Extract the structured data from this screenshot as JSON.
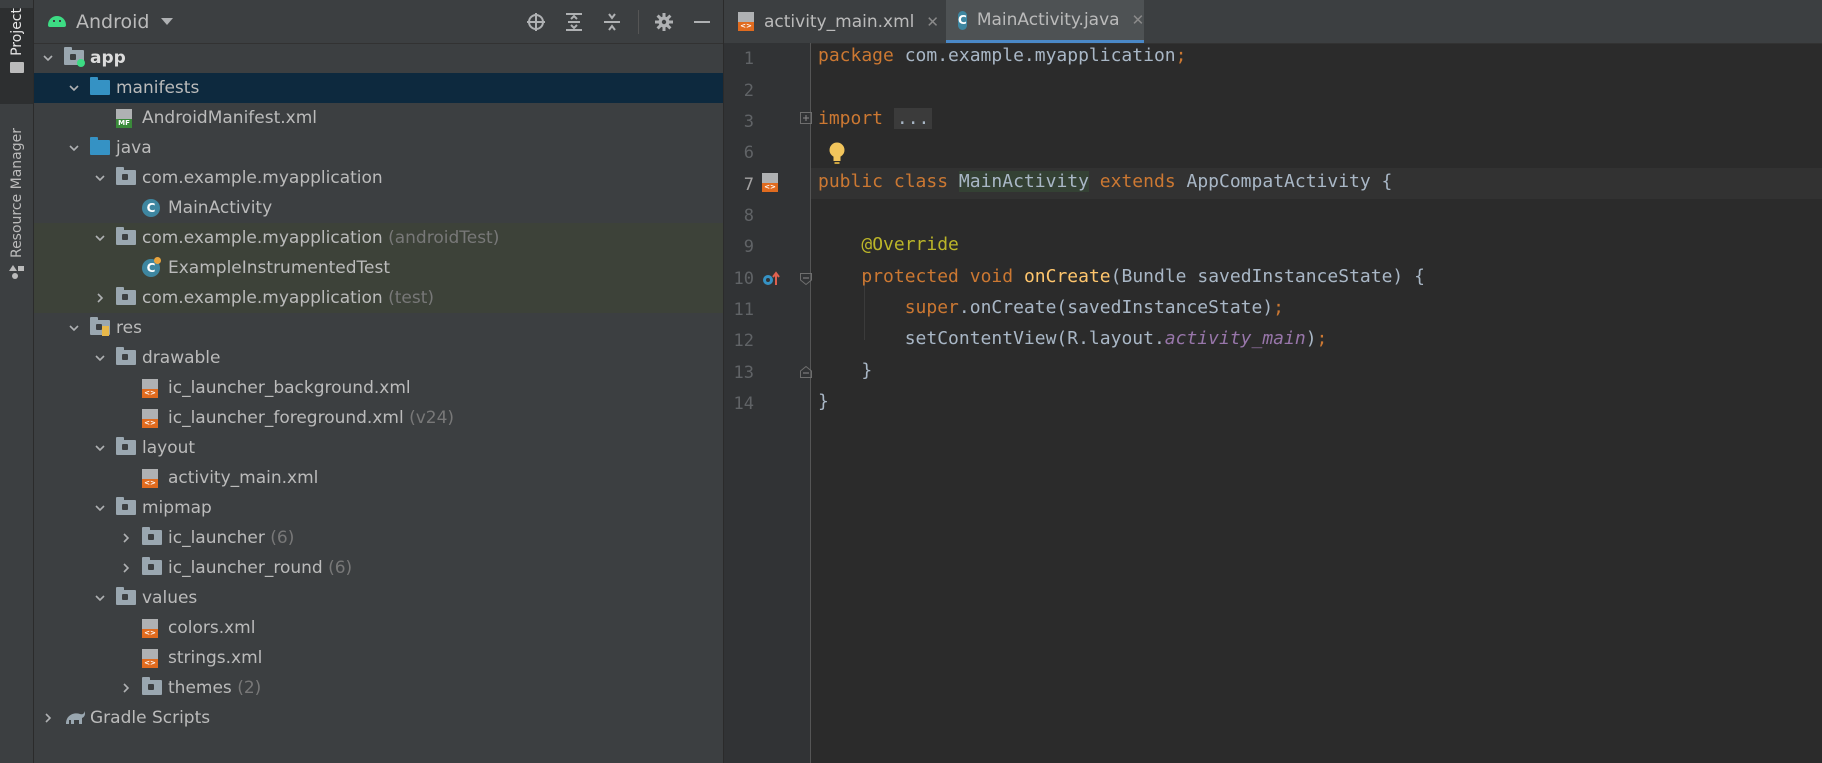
{
  "left_strip": {
    "project_tab": "Project",
    "resource_tab": "Resource Manager"
  },
  "project_panel": {
    "view_label": "Android",
    "tree": [
      {
        "label": "app",
        "suffix": "",
        "level": 0,
        "expand": "open",
        "icon": "module-folder-icon",
        "state": "bold"
      },
      {
        "label": "manifests",
        "suffix": "",
        "level": 1,
        "expand": "open",
        "icon": "blue-folder-icon",
        "state": "selected"
      },
      {
        "label": "AndroidManifest.xml",
        "suffix": "",
        "level": 2,
        "expand": "none",
        "icon": "manifest-file-icon",
        "state": ""
      },
      {
        "label": "java",
        "suffix": "",
        "level": 1,
        "expand": "open",
        "icon": "blue-folder-icon",
        "state": ""
      },
      {
        "label": "com.example.myapplication",
        "suffix": "",
        "level": 2,
        "expand": "open",
        "icon": "package-icon",
        "state": ""
      },
      {
        "label": "MainActivity",
        "suffix": "",
        "level": 3,
        "expand": "none",
        "icon": "class-icon",
        "state": ""
      },
      {
        "label": "com.example.myapplication",
        "suffix": "(androidTest)",
        "level": 2,
        "expand": "open",
        "icon": "package-icon",
        "state": "test"
      },
      {
        "label": "ExampleInstrumentedTest",
        "suffix": "",
        "level": 3,
        "expand": "none",
        "icon": "test-class-icon",
        "state": "test"
      },
      {
        "label": "com.example.myapplication",
        "suffix": "(test)",
        "level": 2,
        "expand": "closed",
        "icon": "package-icon",
        "state": "test"
      },
      {
        "label": "res",
        "suffix": "",
        "level": 1,
        "expand": "open",
        "icon": "res-folder-icon",
        "state": ""
      },
      {
        "label": "drawable",
        "suffix": "",
        "level": 2,
        "expand": "open",
        "icon": "package-icon",
        "state": ""
      },
      {
        "label": "ic_launcher_background.xml",
        "suffix": "",
        "level": 3,
        "expand": "none",
        "icon": "xml-file-icon",
        "state": ""
      },
      {
        "label": "ic_launcher_foreground.xml",
        "suffix": "(v24)",
        "level": 3,
        "expand": "none",
        "icon": "xml-file-icon",
        "state": ""
      },
      {
        "label": "layout",
        "suffix": "",
        "level": 2,
        "expand": "open",
        "icon": "package-icon",
        "state": ""
      },
      {
        "label": "activity_main.xml",
        "suffix": "",
        "level": 3,
        "expand": "none",
        "icon": "xml-file-icon",
        "state": ""
      },
      {
        "label": "mipmap",
        "suffix": "",
        "level": 2,
        "expand": "open",
        "icon": "package-icon",
        "state": ""
      },
      {
        "label": "ic_launcher",
        "suffix": "(6)",
        "level": 3,
        "expand": "closed",
        "icon": "package-icon",
        "state": ""
      },
      {
        "label": "ic_launcher_round",
        "suffix": "(6)",
        "level": 3,
        "expand": "closed",
        "icon": "package-icon",
        "state": ""
      },
      {
        "label": "values",
        "suffix": "",
        "level": 2,
        "expand": "open",
        "icon": "package-icon",
        "state": ""
      },
      {
        "label": "colors.xml",
        "suffix": "",
        "level": 3,
        "expand": "none",
        "icon": "xml-file-icon",
        "state": ""
      },
      {
        "label": "strings.xml",
        "suffix": "",
        "level": 3,
        "expand": "none",
        "icon": "xml-file-icon",
        "state": ""
      },
      {
        "label": "themes",
        "suffix": "(2)",
        "level": 3,
        "expand": "closed",
        "icon": "package-icon",
        "state": ""
      },
      {
        "label": "Gradle Scripts",
        "suffix": "",
        "level": 0,
        "expand": "closed",
        "icon": "gradle-icon",
        "state": ""
      }
    ]
  },
  "editor": {
    "tabs": [
      {
        "label": "activity_main.xml",
        "icon": "xml-file-icon",
        "active": false
      },
      {
        "label": "MainActivity.java",
        "icon": "class-icon",
        "active": true
      }
    ],
    "line_numbers": [
      "1",
      "2",
      "3",
      "6",
      "7",
      "8",
      "9",
      "10",
      "11",
      "12",
      "13",
      "14"
    ],
    "current_line": "7",
    "code": {
      "l1_kw": "package",
      "l1_rest": " com.example.myapplication",
      "l1_semi": ";",
      "l3_kw": "import",
      "l3_fold": "...",
      "l7_public": "public",
      "l7_class": "class",
      "l7_name": "MainActivity",
      "l7_extends": "extends",
      "l7_rest": " AppCompatActivity {",
      "l9_ann": "@Override",
      "l10_protected": "protected",
      "l10_void": "void",
      "l10_fn": "onCreate",
      "l10_rest": "(Bundle savedInstanceState) {",
      "l11_super": "super",
      "l11_rest": ".onCreate(savedInstanceState)",
      "l11_semi": ";",
      "l12_pre": "setContentView(R.layout.",
      "l12_field": "activity_main",
      "l12_post": ")",
      "l12_semi": ";",
      "l13": "}",
      "l14": "}"
    }
  },
  "colors": {
    "keyword": "#cc7832",
    "annotation": "#bbb529",
    "method": "#ffc66d",
    "field": "#9876aa",
    "text": "#a9b7c6",
    "selection": "#0d293e",
    "test_scope": "#3d4239"
  }
}
